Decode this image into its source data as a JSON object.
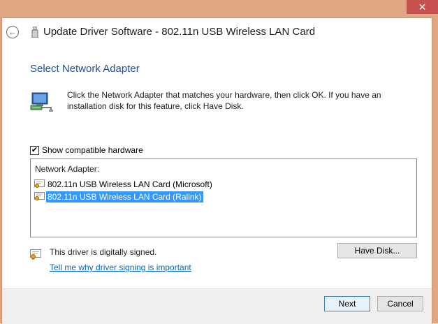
{
  "window": {
    "title": "Update Driver Software - 802.11n USB Wireless LAN Card",
    "close_glyph": "✕"
  },
  "page": {
    "heading": "Select Network Adapter",
    "description": "Click the Network Adapter that matches your hardware, then click OK. If you have an installation disk for this feature, click Have Disk."
  },
  "compatible": {
    "label": "Show compatible hardware",
    "checked": true
  },
  "list": {
    "header": "Network Adapter:",
    "items": [
      {
        "label": "802.11n USB Wireless LAN Card (Microsoft)",
        "selected": false
      },
      {
        "label": "802.11n USB Wireless LAN Card (Ralink)",
        "selected": true
      }
    ]
  },
  "signing": {
    "status": "This driver is digitally signed.",
    "link": "Tell me why driver signing is important"
  },
  "buttons": {
    "have_disk": "Have Disk...",
    "next": "Next",
    "cancel": "Cancel"
  },
  "icons": {
    "back": "back-arrow-icon",
    "title": "usb-device-icon",
    "adapter": "network-adapter-icon",
    "certificate": "certificate-icon"
  },
  "colors": {
    "frame": "#e0a683",
    "close": "#c75050",
    "heading": "#1f4f9a",
    "selection": "#3399ff",
    "link": "#0066cc"
  }
}
